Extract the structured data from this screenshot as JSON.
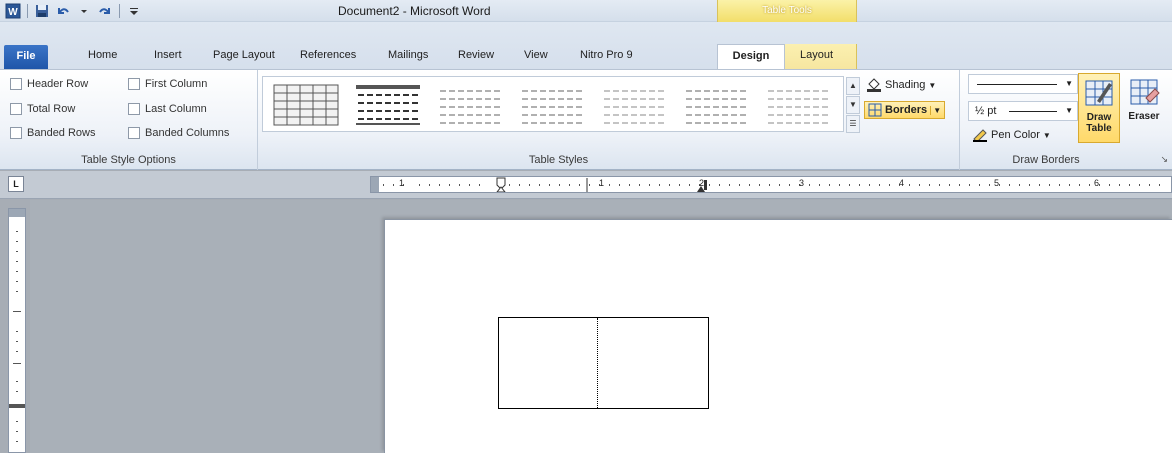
{
  "titlebar": {
    "document_title": "Document2 - Microsoft Word",
    "contextual_group": "Table Tools",
    "qat_icons": [
      "word-app-icon",
      "save-icon",
      "undo-icon",
      "redo-icon",
      "customize-qat-icon"
    ]
  },
  "tabs": [
    {
      "label": "File"
    },
    {
      "label": "Home"
    },
    {
      "label": "Insert"
    },
    {
      "label": "Page Layout"
    },
    {
      "label": "References"
    },
    {
      "label": "Mailings"
    },
    {
      "label": "Review"
    },
    {
      "label": "View"
    },
    {
      "label": "Nitro Pro 9"
    },
    {
      "label": "Design"
    },
    {
      "label": "Layout"
    }
  ],
  "active_tab": "Design",
  "table_style_options": {
    "label": "Table Style Options",
    "options": [
      {
        "label": "Header Row",
        "checked": false
      },
      {
        "label": "First Column",
        "checked": false
      },
      {
        "label": "Total Row",
        "checked": false
      },
      {
        "label": "Last Column",
        "checked": false
      },
      {
        "label": "Banded Rows",
        "checked": false
      },
      {
        "label": "Banded Columns",
        "checked": false
      }
    ]
  },
  "table_styles": {
    "label": "Table Styles",
    "shading_label": "Shading",
    "borders_label": "Borders"
  },
  "draw_borders": {
    "label": "Draw Borders",
    "pen_weight": "½ pt",
    "pen_color_label": "Pen Color",
    "draw_table_line1": "Draw",
    "draw_table_line2": "Table",
    "eraser_label": "Eraser"
  },
  "ruler": {
    "numbers": [
      "1",
      "1",
      "2",
      "3",
      "4",
      "5",
      "6"
    ],
    "toggle_glyph": "L"
  },
  "colors": {
    "accent_blue": "#2a5caa",
    "highlight_yellow": "#ffd96a",
    "ribbon_bg": "#eef2f8"
  }
}
